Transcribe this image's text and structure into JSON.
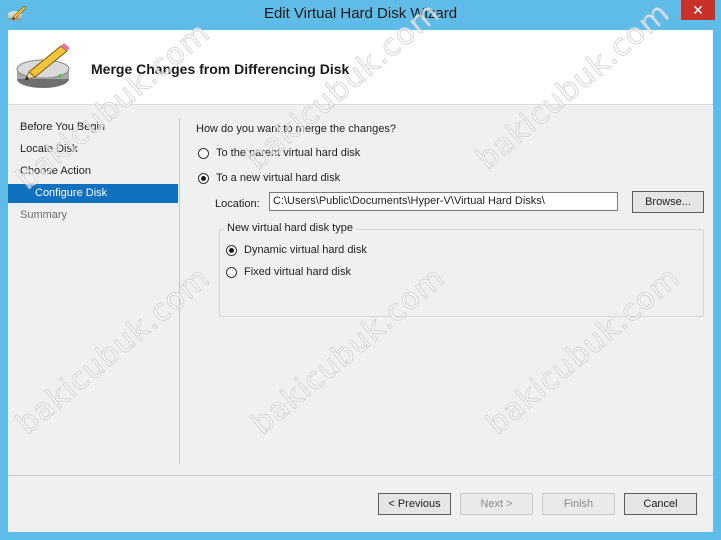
{
  "window": {
    "title": "Edit Virtual Hard Disk Wizard",
    "close_glyph": "✕"
  },
  "header": {
    "title": "Merge Changes from Differencing Disk",
    "icon": "disk-pencil-icon"
  },
  "steps": [
    {
      "label": "Before You Begin",
      "state": "normal"
    },
    {
      "label": "Locate Disk",
      "state": "normal"
    },
    {
      "label": "Choose Action",
      "state": "normal"
    },
    {
      "label": "Configure Disk",
      "state": "active"
    },
    {
      "label": "Summary",
      "state": "disabled"
    }
  ],
  "content": {
    "question": "How do you want to merge the changes?",
    "options": [
      {
        "label": "To the parent virtual hard disk",
        "checked": false
      },
      {
        "label": "To a new virtual hard disk",
        "checked": true
      }
    ],
    "location_label": "Location:",
    "location_value": "C:\\Users\\Public\\Documents\\Hyper-V\\Virtual Hard Disks\\",
    "browse_label": "Browse...",
    "disk_type": {
      "title": "New virtual hard disk type",
      "options": [
        {
          "label": "Dynamic virtual hard disk",
          "checked": true
        },
        {
          "label": "Fixed virtual hard disk",
          "checked": false
        }
      ]
    }
  },
  "footer": {
    "previous": "< Previous",
    "next": "Next >",
    "finish": "Finish",
    "cancel": "Cancel"
  },
  "watermark": "bakicubuk.com",
  "colors": {
    "titlebar": "#5fbbe8",
    "active_step": "#0f71bf",
    "close": "#c7312a"
  }
}
